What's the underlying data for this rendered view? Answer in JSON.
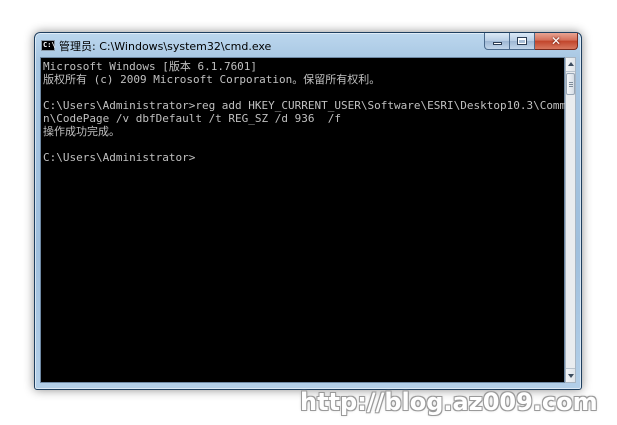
{
  "window": {
    "title": "管理员: C:\\Windows\\system32\\cmd.exe",
    "icon": "console-app-icon",
    "buttons": {
      "minimize": "minimize-icon",
      "maximize": "maximize-icon",
      "close": "close-icon",
      "close_glyph": "✕"
    }
  },
  "console": {
    "lines": [
      "Microsoft Windows [版本 6.1.7601]",
      "版权所有 (c) 2009 Microsoft Corporation。保留所有权利。",
      "",
      "C:\\Users\\Administrator>reg add HKEY_CURRENT_USER\\Software\\ESRI\\Desktop10.3\\Commo",
      "n\\CodePage /v dbfDefault /t REG_SZ /d 936  /f",
      "操作成功完成。",
      "",
      "C:\\Users\\Administrator>"
    ],
    "text_color": "#c0c0c0",
    "background": "#000000"
  },
  "scrollbar": {
    "position_fraction": 0.0
  },
  "watermark": {
    "text": "http://blog.az009.com"
  }
}
